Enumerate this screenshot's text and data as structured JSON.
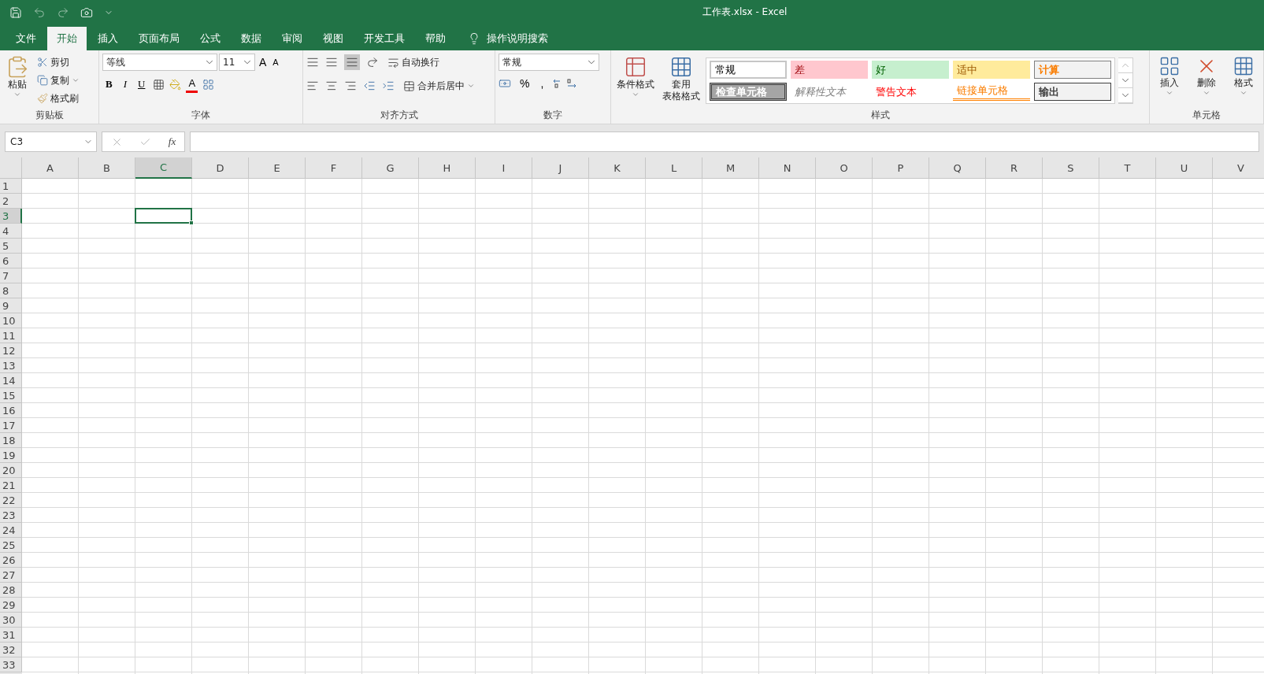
{
  "title": "工作表.xlsx  -  Excel",
  "tabs": [
    {
      "label": "文件",
      "selected": false
    },
    {
      "label": "开始",
      "selected": true
    },
    {
      "label": "插入",
      "selected": false
    },
    {
      "label": "页面布局",
      "selected": false
    },
    {
      "label": "公式",
      "selected": false
    },
    {
      "label": "数据",
      "selected": false
    },
    {
      "label": "审阅",
      "selected": false
    },
    {
      "label": "视图",
      "selected": false
    },
    {
      "label": "开发工具",
      "selected": false
    },
    {
      "label": "帮助",
      "selected": false
    }
  ],
  "tell_me": "操作说明搜索",
  "clipboard": {
    "paste": "粘贴",
    "cut": "剪切",
    "copy": "复制",
    "format_painter": "格式刷",
    "label": "剪贴板"
  },
  "font": {
    "name": "等线",
    "size": "11",
    "grow": "A",
    "shrink": "A",
    "bold": "B",
    "italic": "I",
    "underline": "U",
    "text_color_button": "A",
    "label": "字体"
  },
  "alignment": {
    "wrap": "自动换行",
    "merge": "合并后居中",
    "label": "对齐方式"
  },
  "number": {
    "format": "常规",
    "percent": "%",
    "comma": ",",
    "label": "数字"
  },
  "styles": {
    "conditional": "条件格式",
    "table_line_1": "套用",
    "table_line_2": "表格格式",
    "label": "样式",
    "cell_styles": [
      {
        "name": "常规",
        "kind": "normal"
      },
      {
        "name": "差",
        "kind": "bad"
      },
      {
        "name": "好",
        "kind": "good"
      },
      {
        "name": "适中",
        "kind": "neutral"
      },
      {
        "name": "计算",
        "kind": "calculation"
      },
      {
        "name": "检查单元格",
        "kind": "check"
      },
      {
        "name": "解释性文本",
        "kind": "explanatory"
      },
      {
        "name": "警告文本",
        "kind": "warning"
      },
      {
        "name": "链接单元格",
        "kind": "linked"
      },
      {
        "name": "输出",
        "kind": "output"
      }
    ]
  },
  "cells": {
    "insert": "插入",
    "delete": "删除",
    "format": "格式",
    "label": "单元格"
  },
  "name_box": "C3",
  "function_label": "fx",
  "columns": [
    {
      "label": "A",
      "selected": false
    },
    {
      "label": "B",
      "selected": false
    },
    {
      "label": "C",
      "selected": true
    },
    {
      "label": "D",
      "selected": false
    },
    {
      "label": "E",
      "selected": false
    },
    {
      "label": "F",
      "selected": false
    },
    {
      "label": "G",
      "selected": false
    },
    {
      "label": "H",
      "selected": false
    },
    {
      "label": "I",
      "selected": false
    },
    {
      "label": "J",
      "selected": false
    },
    {
      "label": "K",
      "selected": false
    },
    {
      "label": "L",
      "selected": false
    },
    {
      "label": "M",
      "selected": false
    },
    {
      "label": "N",
      "selected": false
    },
    {
      "label": "O",
      "selected": false
    },
    {
      "label": "P",
      "selected": false
    },
    {
      "label": "Q",
      "selected": false
    },
    {
      "label": "R",
      "selected": false
    },
    {
      "label": "S",
      "selected": false
    },
    {
      "label": "T",
      "selected": false
    },
    {
      "label": "U",
      "selected": false
    },
    {
      "label": "V",
      "selected": false
    }
  ],
  "rows": [
    {
      "label": "1",
      "selected": false
    },
    {
      "label": "2",
      "selected": false
    },
    {
      "label": "3",
      "selected": true
    },
    {
      "label": "4",
      "selected": false
    },
    {
      "label": "5",
      "selected": false
    },
    {
      "label": "6",
      "selected": false
    },
    {
      "label": "7",
      "selected": false
    },
    {
      "label": "8",
      "selected": false
    },
    {
      "label": "9",
      "selected": false
    },
    {
      "label": "10",
      "selected": false
    },
    {
      "label": "11",
      "selected": false
    },
    {
      "label": "12",
      "selected": false
    },
    {
      "label": "13",
      "selected": false
    },
    {
      "label": "14",
      "selected": false
    },
    {
      "label": "15",
      "selected": false
    },
    {
      "label": "16",
      "selected": false
    },
    {
      "label": "17",
      "selected": false
    },
    {
      "label": "18",
      "selected": false
    },
    {
      "label": "19",
      "selected": false
    },
    {
      "label": "20",
      "selected": false
    },
    {
      "label": "21",
      "selected": false
    },
    {
      "label": "22",
      "selected": false
    },
    {
      "label": "23",
      "selected": false
    },
    {
      "label": "24",
      "selected": false
    },
    {
      "label": "25",
      "selected": false
    },
    {
      "label": "26",
      "selected": false
    },
    {
      "label": "27",
      "selected": false
    },
    {
      "label": "28",
      "selected": false
    },
    {
      "label": "29",
      "selected": false
    },
    {
      "label": "30",
      "selected": false
    },
    {
      "label": "31",
      "selected": false
    },
    {
      "label": "32",
      "selected": false
    },
    {
      "label": "33",
      "selected": false
    }
  ]
}
